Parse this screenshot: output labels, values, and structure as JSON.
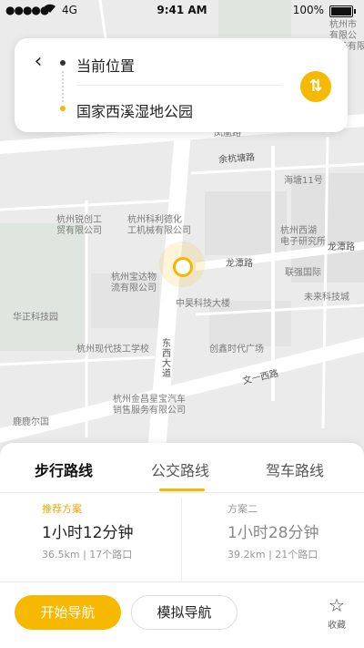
{
  "status_bar": {
    "network": "4G",
    "time": "9:41 AM",
    "battery": "100%"
  },
  "route": {
    "from": "当前位置",
    "to": "国家西溪湿地公园"
  },
  "map_labels": {
    "yuhang_road": "余杭塘路",
    "fenghuang_road": "凤凰路",
    "haitang": "海塘11号",
    "ruichuang": "杭州锐创工\n贸有限公司",
    "keli": "杭州科利德化\n工机械有限公司",
    "baoda": "杭州宝达物\n流有限公司",
    "huazheng": "华正科技园",
    "xiandai": "杭州现代技工学校",
    "jinchang": "杭州金昌星宝汽车\n销售服务有限公司",
    "xixi_electronic": "杭州西湖\n电子研究所",
    "lianqiang": "联强国际",
    "weilai": "未来科技城",
    "zhongda": "中昊科技大楼",
    "chuangyi": "创鑫时代广场",
    "longtan_1": "龙潭路",
    "longtan_2": "龙潭路",
    "wenyi": "文一西路",
    "dongxi": "东\n西\n大\n道",
    "dengyun": "杭州市\n有限公\n设备有限公",
    "bottom_left": "鹿鹿尔国"
  },
  "tabs": [
    {
      "label": "步行路线",
      "active": true
    },
    {
      "label": "公交路线",
      "active": false
    },
    {
      "label": "驾车路线",
      "active": false
    }
  ],
  "plans": [
    {
      "tag": "推荐方案",
      "time": "1小时12分钟",
      "meta": "36.5km | 17个路口",
      "highlight": true
    },
    {
      "tag": "方案二",
      "time": "1小时28分钟",
      "meta": "39.2km | 21个路口",
      "highlight": false
    }
  ],
  "actions": {
    "start": "开始导航",
    "simulate": "模拟导航",
    "favorite": "收藏"
  },
  "colors": {
    "accent": "#f7b800",
    "map_bg": "#ebebeb"
  }
}
